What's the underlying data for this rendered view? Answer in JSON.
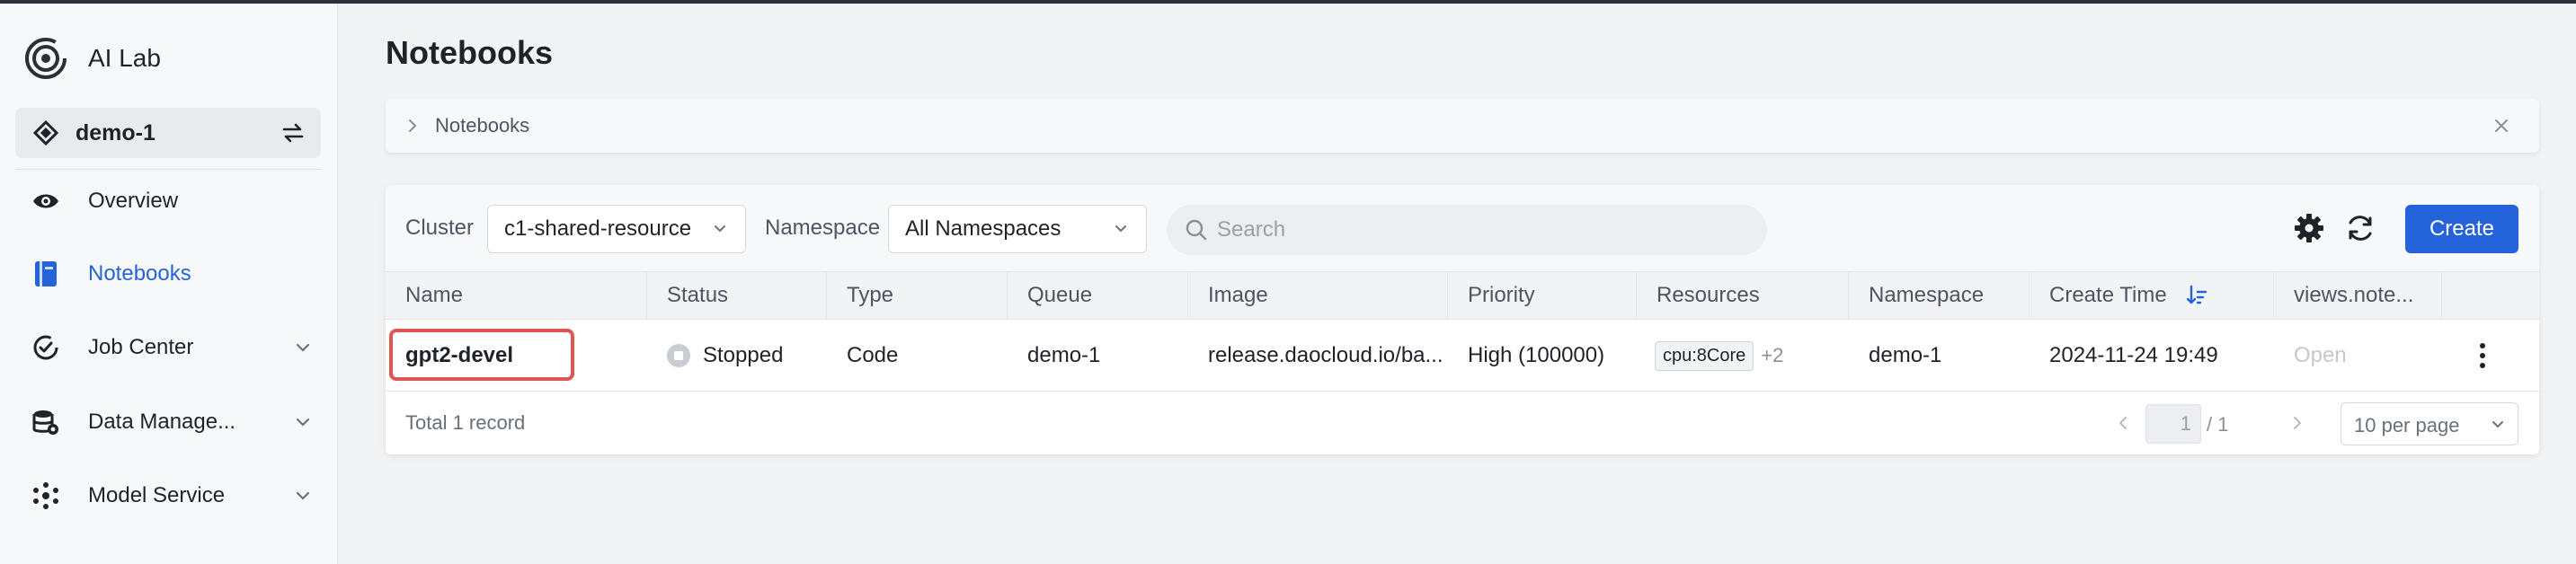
{
  "app": {
    "name": "AI Lab"
  },
  "workspace": {
    "name": "demo-1"
  },
  "nav": [
    {
      "label": "Overview",
      "icon": "eye-icon",
      "active": false,
      "expandable": false
    },
    {
      "label": "Notebooks",
      "icon": "notebook-icon",
      "active": true,
      "expandable": false
    },
    {
      "label": "Job Center",
      "icon": "job-check-icon",
      "active": false,
      "expandable": true
    },
    {
      "label": "Data Manage...",
      "icon": "database-gear-icon",
      "active": false,
      "expandable": true
    },
    {
      "label": "Model Service",
      "icon": "model-network-icon",
      "active": false,
      "expandable": true
    }
  ],
  "page": {
    "title": "Notebooks"
  },
  "breadcrumb": {
    "label": "Notebooks"
  },
  "filters": {
    "cluster_label": "Cluster",
    "cluster_value": "c1-shared-resource",
    "namespace_label": "Namespace",
    "namespace_value": "All Namespaces",
    "search_placeholder": "Search"
  },
  "toolbar": {
    "create_label": "Create"
  },
  "table": {
    "columns": [
      "Name",
      "Status",
      "Type",
      "Queue",
      "Image",
      "Priority",
      "Resources",
      "Namespace",
      "Create Time",
      "views.note..."
    ],
    "rows": [
      {
        "name": "gpt2-devel",
        "status": "Stopped",
        "type": "Code",
        "queue": "demo-1",
        "image": "release.daocloud.io/ba...",
        "priority": "High (100000)",
        "resource_tag": "cpu:8Core",
        "resource_more": "+2",
        "namespace": "demo-1",
        "create_time": "2024-11-24 19:49",
        "open_label": "Open"
      }
    ]
  },
  "pagination": {
    "total_text": "Total 1 record",
    "current_page": "1",
    "total_pages": "/ 1",
    "page_size": "10 per page"
  },
  "colors": {
    "accent": "#2463d9",
    "highlight_box": "#e0554f",
    "sidebar_bg": "#f7f8fa"
  }
}
